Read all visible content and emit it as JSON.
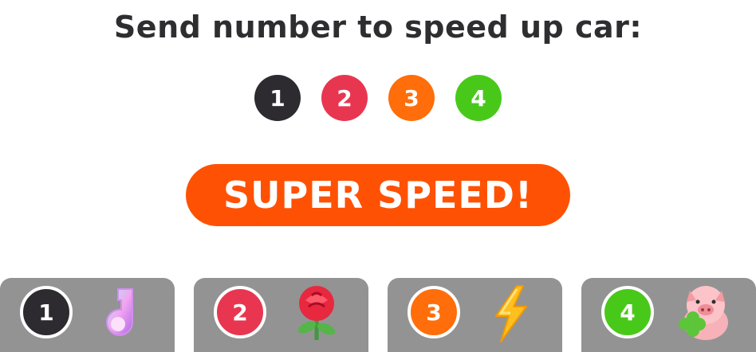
{
  "title": "Send number to speed up car:",
  "numbers": [
    {
      "label": "1",
      "color": "#2e2b30"
    },
    {
      "label": "2",
      "color": "#e83651"
    },
    {
      "label": "3",
      "color": "#ff6e0a"
    },
    {
      "label": "4",
      "color": "#48c91a"
    }
  ],
  "super_speed_label": "SUPER SPEED!",
  "super_speed_color": "#ff5104",
  "gifts": [
    {
      "number": "1",
      "color": "#2e2b30",
      "icon": "music-note-gift-icon"
    },
    {
      "number": "2",
      "color": "#e83651",
      "icon": "rose-gift-icon"
    },
    {
      "number": "3",
      "color": "#ff6e0a",
      "icon": "lightning-gift-icon"
    },
    {
      "number": "4",
      "color": "#48c91a",
      "icon": "pig-clover-gift-icon"
    }
  ]
}
